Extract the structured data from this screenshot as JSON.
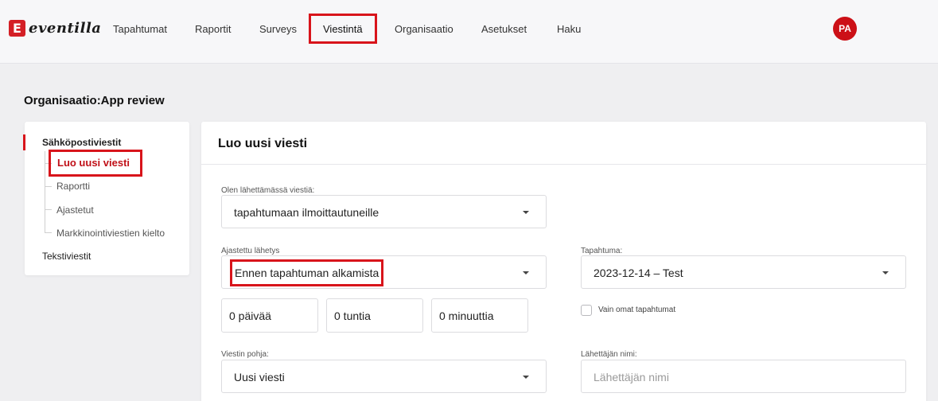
{
  "app": {
    "logo_text": "eventilla",
    "logo_mark": "E"
  },
  "nav": {
    "items": [
      {
        "label": "Tapahtumat"
      },
      {
        "label": "Raportit"
      },
      {
        "label": "Surveys"
      },
      {
        "label": "Viestintä",
        "active": true
      },
      {
        "label": "Organisaatio"
      },
      {
        "label": "Asetukset"
      },
      {
        "label": "Haku"
      }
    ],
    "avatar_initials": "PA"
  },
  "page": {
    "org_title": "Organisaatio:App review"
  },
  "sidebar": {
    "email_section": "Sähköpostiviestit",
    "items": [
      {
        "label": "Luo uusi viesti",
        "active": true
      },
      {
        "label": "Raportti"
      },
      {
        "label": "Ajastetut"
      },
      {
        "label": "Markkinointiviestien kielto"
      }
    ],
    "sms_section": "Tekstiviestit"
  },
  "form": {
    "title": "Luo uusi viesti",
    "sending_to_label": "Olen lähettämässä viestiä:",
    "sending_to_value": "tapahtumaan ilmoittautuneille",
    "scheduled_label": "Ajastettu lähetys",
    "scheduled_value": "Ennen tapahtuman alkamista",
    "days_value": "0 päivää",
    "hours_value": "0 tuntia",
    "minutes_value": "0 minuuttia",
    "event_label": "Tapahtuma:",
    "event_value": "2023-12-14 – Test",
    "own_events_label": "Vain omat tapahtumat",
    "own_events_checked": false,
    "template_label": "Viestin pohja:",
    "template_value": "Uusi viesti",
    "sender_label": "Lähettäjän nimi:",
    "sender_placeholder": "Lähettäjän nimi",
    "sender_value": ""
  },
  "colors": {
    "accent": "#d8141b",
    "avatar": "#cc1017",
    "background": "#efeff1"
  }
}
